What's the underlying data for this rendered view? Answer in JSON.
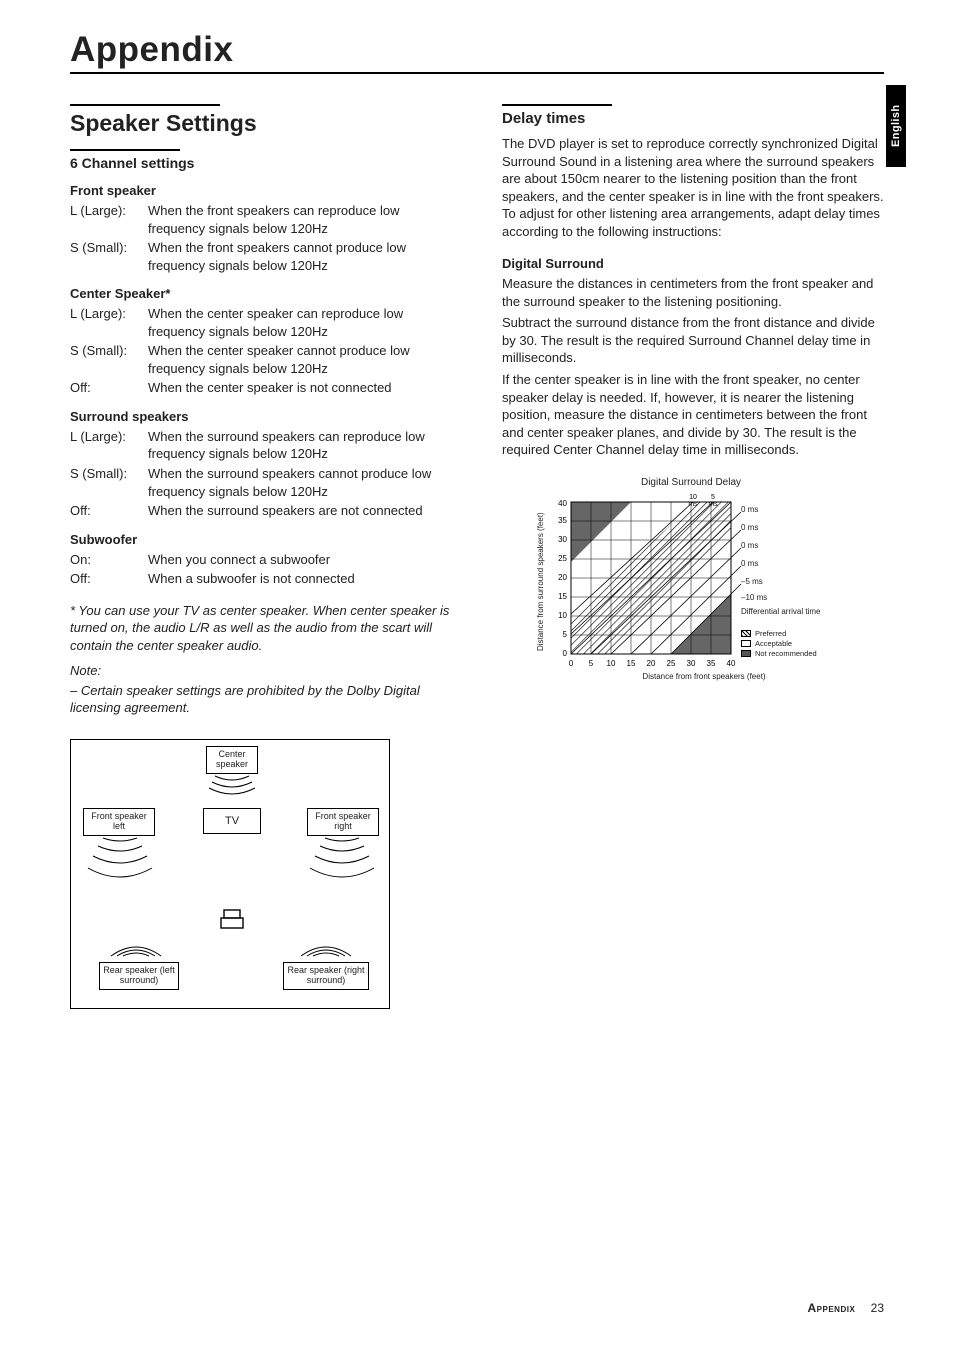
{
  "header": {
    "appendix": "Appendix"
  },
  "side_tab": "English",
  "left": {
    "section_title": "Speaker Settings",
    "subsection_title": "6 Channel settings",
    "front": {
      "title": "Front speaker",
      "l_label": "L (Large):",
      "l_text": "When the front speakers can reproduce low frequency signals below 120Hz",
      "s_label": "S (Small):",
      "s_text": "When the front speakers cannot produce low frequency signals below 120Hz"
    },
    "center": {
      "title": "Center Speaker*",
      "l_label": "L (Large):",
      "l_text": "When the center speaker can reproduce low frequency signals below 120Hz",
      "s_label": "S (Small):",
      "s_text": "When the center speaker cannot produce low frequency signals below 120Hz",
      "off_label": "Off:",
      "off_text": "When the center speaker is not connected"
    },
    "surround": {
      "title": "Surround speakers",
      "l_label": "L (Large):",
      "l_text": "When the surround speakers can reproduce  low frequency signals below 120Hz",
      "s_label": "S (Small):",
      "s_text": "When the surround speakers cannot produce low frequency signals below 120Hz",
      "off_label": "Off:",
      "off_text": "When the surround speakers are not connected"
    },
    "sub": {
      "title": "Subwoofer",
      "on_label": "On:",
      "on_text": "When you connect a subwoofer",
      "off_label": "Off:",
      "off_text": "When a subwoofer is not connected"
    },
    "footnote": "* You can use your TV as center speaker. When center speaker is turned on, the audio L/R as well as the audio from the scart will contain the center speaker audio.",
    "note_label": "Note:",
    "note_text": "–   Certain speaker settings are prohibited by the Dolby Digital licensing agreement.",
    "diagram": {
      "center": "Center\nspeaker",
      "front_left": "Front speaker\nleft",
      "tv": "TV",
      "front_right": "Front speaker\nright",
      "rear_left": "Rear speaker\n(left surround)",
      "rear_right": "Rear speaker\n(right surround)"
    }
  },
  "right": {
    "section_title": "Delay times",
    "intro": "The DVD player is set to reproduce correctly synchronized Digital Surround Sound in a listening area where the surround speakers are about 150cm nearer to the listening position than the front speakers, and the center speaker is in line with the front speakers. To adjust for other listening area arrangements, adapt delay times according to the following instructions:",
    "ds_title": "Digital Surround",
    "ds_p1": "Measure the distances in centimeters from the front speaker and the surround speaker to the listening positioning.",
    "ds_p2": "Subtract the surround distance from the front distance and divide by 30. The result is the required Surround Channel delay time in milliseconds.",
    "ds_p3": "If the center speaker is in line with the front speaker, no center speaker delay is needed. If, however, it is nearer the listening position, measure the distance in centimeters between the front and center speaker planes, and divide by 30. The result is the required Center Channel delay time in milliseconds.",
    "chart": {
      "title": "Digital Surround Delay",
      "xlabel": "Distance from front speakers (feet)",
      "ylabel": "Distance from surround speakers (feet)",
      "top_labels": {
        "a": "10\nms",
        "b": "5\nms"
      },
      "right_labels": [
        "0 ms",
        "0 ms",
        "0 ms",
        "0 ms",
        "–5 ms",
        "–10 ms",
        "Differential\narrival time"
      ],
      "legend": {
        "pref": "Preferred",
        "acc": "Acceptable",
        "nrec": "Not recommended"
      }
    }
  },
  "footer": {
    "section": "Appendix",
    "page": "23"
  },
  "chart_data": {
    "type": "heatmap",
    "title": "Digital Surround Delay",
    "xlabel": "Distance from front speakers (feet)",
    "ylabel": "Distance from surround speakers (feet)",
    "xlim": [
      0,
      40
    ],
    "ylim": [
      0,
      40
    ],
    "x_ticks": [
      0,
      5,
      10,
      15,
      20,
      25,
      30,
      35,
      40
    ],
    "y_ticks": [
      0,
      5,
      10,
      15,
      20,
      25,
      30,
      35,
      40
    ],
    "diagonal_lines_ms": [
      10,
      5,
      0,
      0,
      0,
      0,
      -5,
      -10
    ],
    "right_annotation_label": "Differential arrival time",
    "zones": [
      "Preferred",
      "Acceptable",
      "Not recommended"
    ]
  }
}
